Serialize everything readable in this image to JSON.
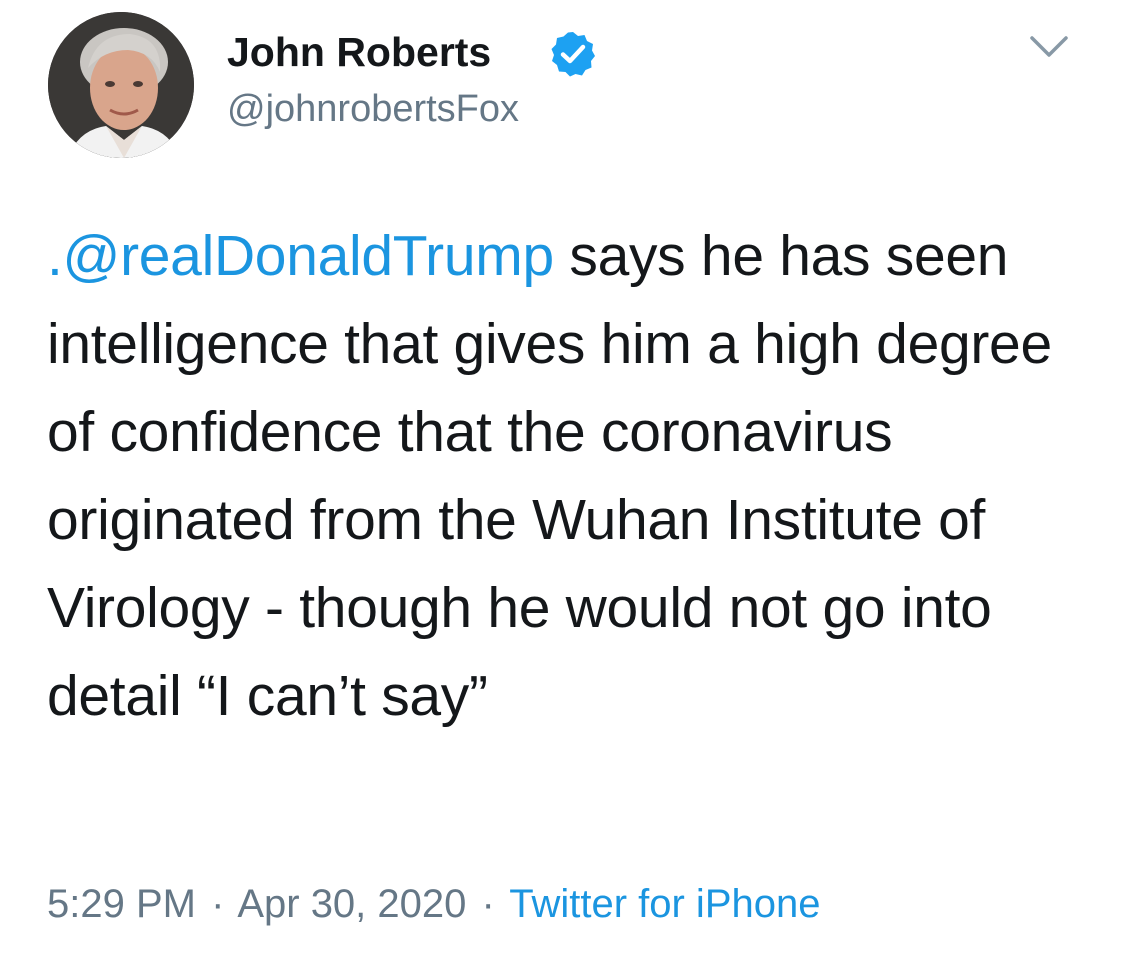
{
  "author": {
    "display_name": "John Roberts",
    "handle": "@johnrobertsFox",
    "verified": true
  },
  "tweet": {
    "mention": ".@realDonaldTrump",
    "text": " says he has seen intelligence that gives him a high degree of confidence that the coronavirus originated from the Wuhan Institute of Virology - though he would not go into detail “I can’t say”"
  },
  "meta": {
    "time": "5:29 PM",
    "separator": "·",
    "date": "Apr 30, 2020",
    "source": "Twitter for iPhone"
  },
  "colors": {
    "accent": "#1b95e0",
    "text": "#14171a",
    "secondary": "#657786"
  },
  "icons": {
    "verified": "verified-badge-icon",
    "menu": "chevron-down-icon"
  }
}
